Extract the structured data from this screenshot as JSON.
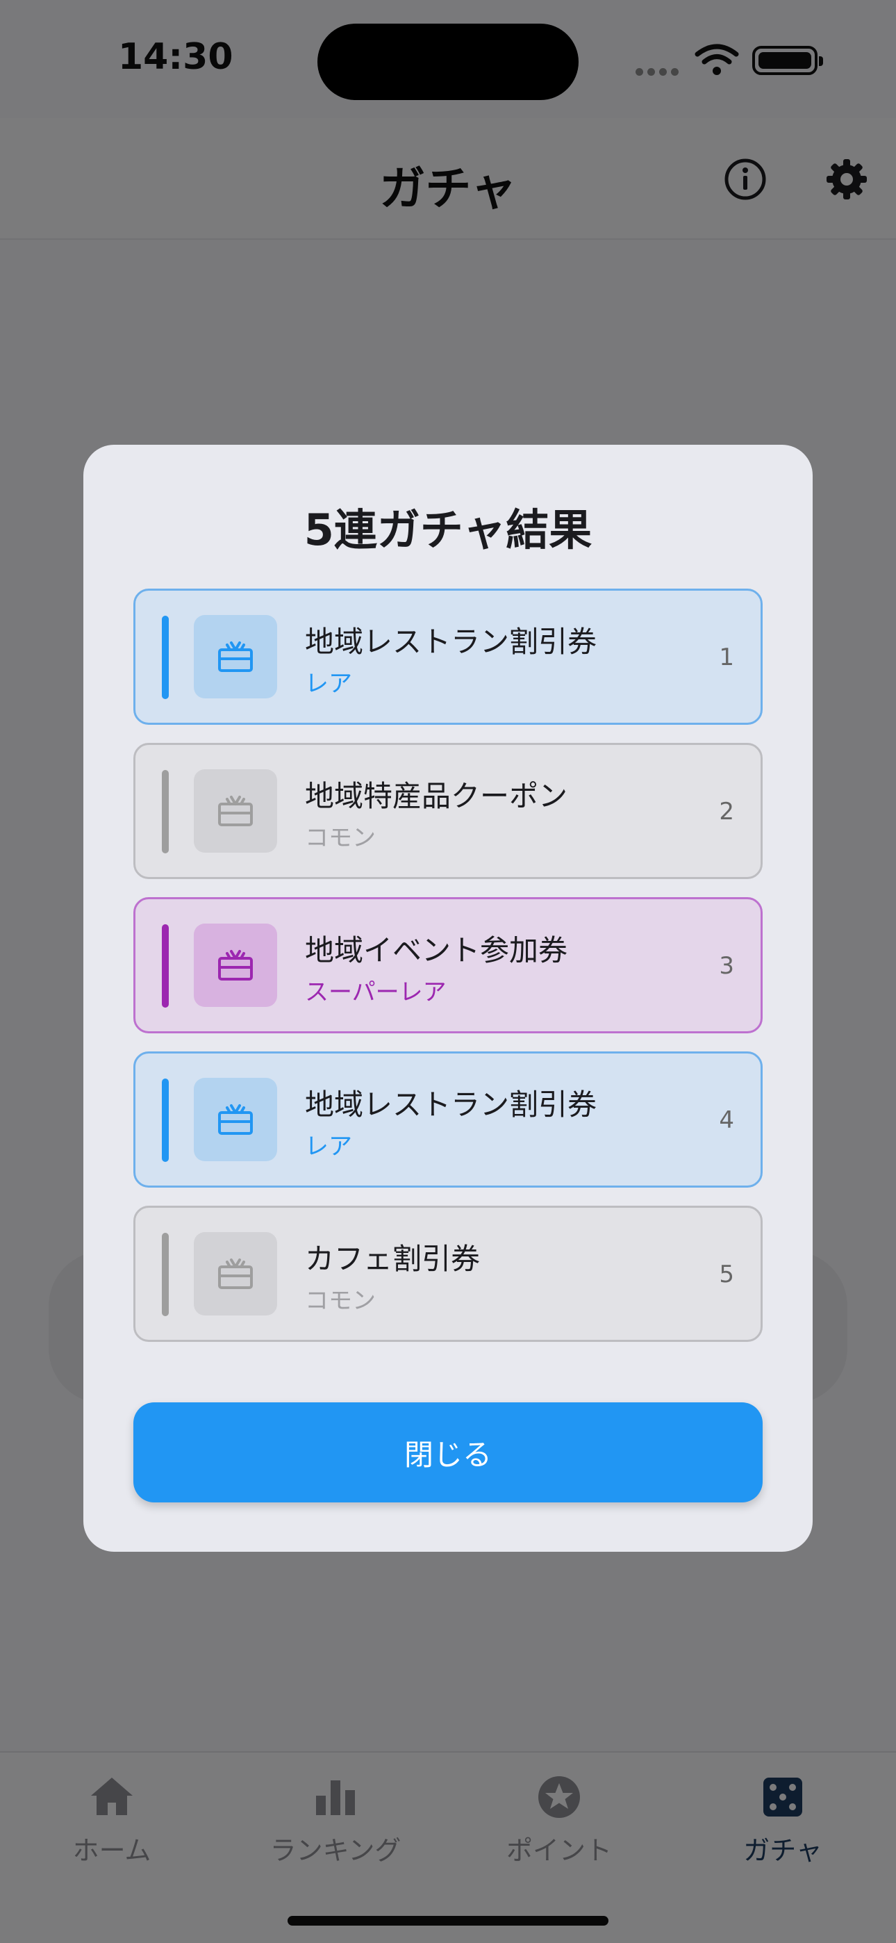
{
  "status_bar": {
    "time": "14:30"
  },
  "header": {
    "title": "ガチャ",
    "info_icon": "info-icon",
    "settings_icon": "gear-icon"
  },
  "tab_bar": {
    "tabs": [
      {
        "label": "ホーム",
        "icon": "home-icon",
        "active": false
      },
      {
        "label": "ランキング",
        "icon": "bar-chart-icon",
        "active": false
      },
      {
        "label": "ポイント",
        "icon": "star-circle-icon",
        "active": false
      },
      {
        "label": "ガチャ",
        "icon": "dice-icon",
        "active": true
      }
    ]
  },
  "modal": {
    "title": "5連ガチャ結果",
    "results": [
      {
        "name": "地域レストラン割引券",
        "rarity": "レア",
        "index": "1",
        "icon": "gift-card-icon"
      },
      {
        "name": "地域特産品クーポン",
        "rarity": "コモン",
        "index": "2",
        "icon": "gift-card-icon"
      },
      {
        "name": "地域イベント参加券",
        "rarity": "スーパーレア",
        "index": "3",
        "icon": "gift-card-icon"
      },
      {
        "name": "地域レストラン割引券",
        "rarity": "レア",
        "index": "4",
        "icon": "gift-card-icon"
      },
      {
        "name": "カフェ割引券",
        "rarity": "コモン",
        "index": "5",
        "icon": "gift-card-icon"
      }
    ],
    "close_label": "閉じる"
  },
  "colors": {
    "rare": "#2196f3",
    "common": "#9e9e9e",
    "super_rare": "#9c27b0",
    "primary_button": "#2196f3",
    "active_tab": "#1d3a5e"
  }
}
